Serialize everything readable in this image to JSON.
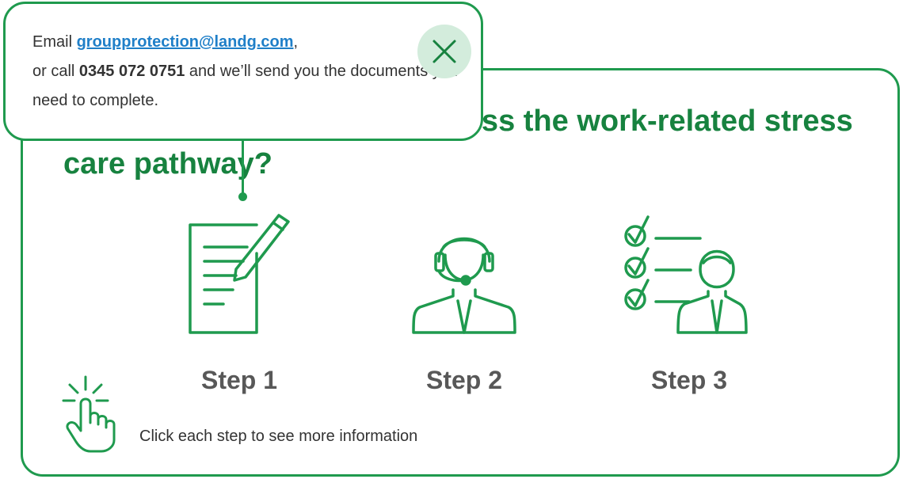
{
  "card": {
    "title": "How do your customers access the work-related stress care pathway?"
  },
  "steps": [
    {
      "label": "Step 1",
      "icon": "document-pencil-icon"
    },
    {
      "label": "Step 2",
      "icon": "headset-agent-icon"
    },
    {
      "label": "Step 3",
      "icon": "checklist-person-icon"
    }
  ],
  "hint": {
    "icon": "tap-hand-icon",
    "text": "Click each step to see more information"
  },
  "tooltip": {
    "prefix": "Email ",
    "email": "groupprotection@landg.com",
    "after_email": ",",
    "call_prefix": "or call ",
    "phone": "0345 072 0751",
    "suffix": " and we’ll send you the documents you need to complete.",
    "close_icon": "close-icon"
  },
  "colors": {
    "accent": "#1f9a4e",
    "heading": "#17823f",
    "link": "#1f7fc8",
    "close_bg": "#d3ecdc",
    "step_label": "#585858"
  }
}
